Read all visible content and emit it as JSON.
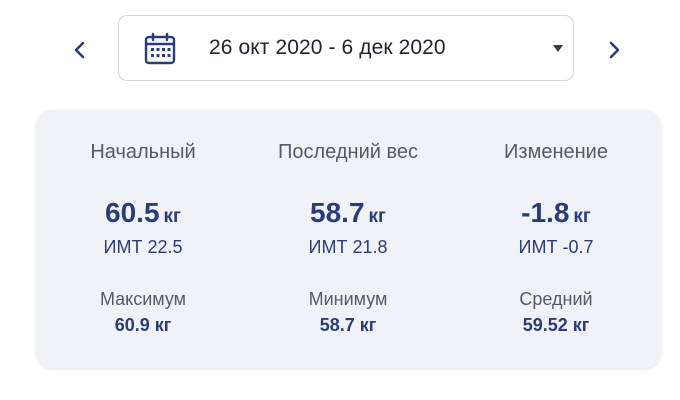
{
  "date_range": {
    "label": "26 окт 2020 - 6 дек 2020",
    "prev_icon": "chevron-left-icon",
    "next_icon": "chevron-right-icon",
    "calendar_icon": "calendar-icon",
    "dropdown_icon": "caret-down-icon"
  },
  "colors": {
    "accent": "#2b3d78",
    "muted_text": "#555a66",
    "card_bg": "#f0f2f7"
  },
  "stats": {
    "start": {
      "label": "Начальный",
      "value": "60.5",
      "unit": "кг",
      "bmi": "ИМТ 22.5",
      "sub_label": "Максимум",
      "sub_value": "60.9 кг"
    },
    "last": {
      "label": "Последний вес",
      "value": "58.7",
      "unit": "кг",
      "bmi": "ИМТ 21.8",
      "sub_label": "Минимум",
      "sub_value": "58.7 кг"
    },
    "change": {
      "label": "Изменение",
      "value": "-1.8",
      "unit": "кг",
      "bmi": "ИМТ -0.7",
      "sub_label": "Средний",
      "sub_value": "59.52 кг"
    }
  }
}
